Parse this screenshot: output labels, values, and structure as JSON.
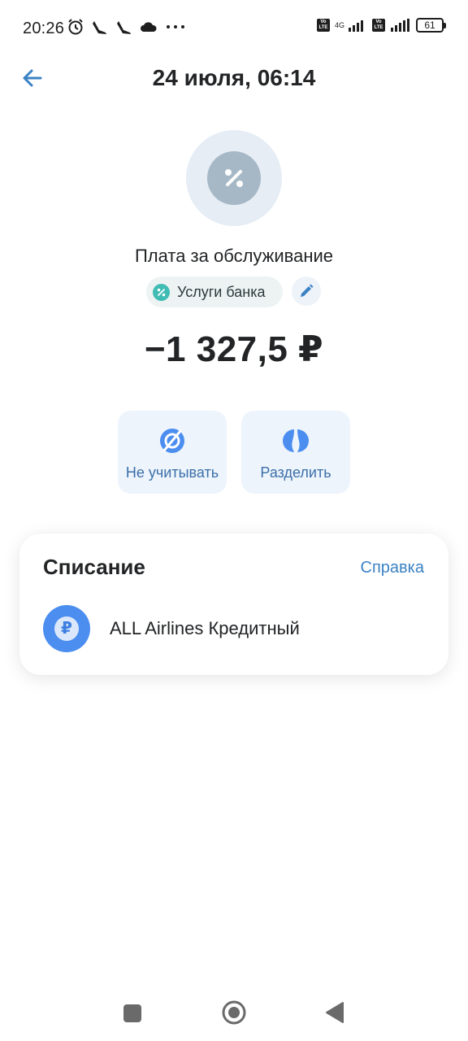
{
  "status_bar": {
    "time": "20:26",
    "network_label": "4G",
    "volte_label": "Vo LTE",
    "battery": "61",
    "left_icons": [
      "alarm-icon",
      "shoe-icon",
      "shoe-icon",
      "cloud-icon",
      "more-dots-icon"
    ],
    "right_icons": [
      "volte-icon",
      "signal-icon",
      "volte-icon",
      "signal-icon",
      "battery-icon"
    ]
  },
  "header": {
    "title": "24 июля, 06:14",
    "back_icon": "arrow-left-icon"
  },
  "operation": {
    "icon": "percent-icon",
    "name": "Плата за обслуживание",
    "category": {
      "label": "Услуги банка",
      "icon": "percent-icon",
      "color": "#3fbcb4"
    },
    "edit_icon": "pencil-icon",
    "amount": "−1 327,5 ₽"
  },
  "actions": [
    {
      "label": "Не учитывать",
      "icon": "exclude-icon"
    },
    {
      "label": "Разделить",
      "icon": "split-icon"
    }
  ],
  "card": {
    "title": "Списание",
    "link": "Справка",
    "account": {
      "name": "ALL Airlines Кредитный",
      "icon_glyph": "₽",
      "icon": "ruble-coin-icon"
    }
  },
  "colors": {
    "accent": "#3b82c4",
    "action_bg": "#edf4fc",
    "category_circle": "#e6edf5"
  },
  "nav_bar": {
    "icons": [
      "recents-square-icon",
      "home-circle-icon",
      "back-triangle-icon"
    ]
  }
}
